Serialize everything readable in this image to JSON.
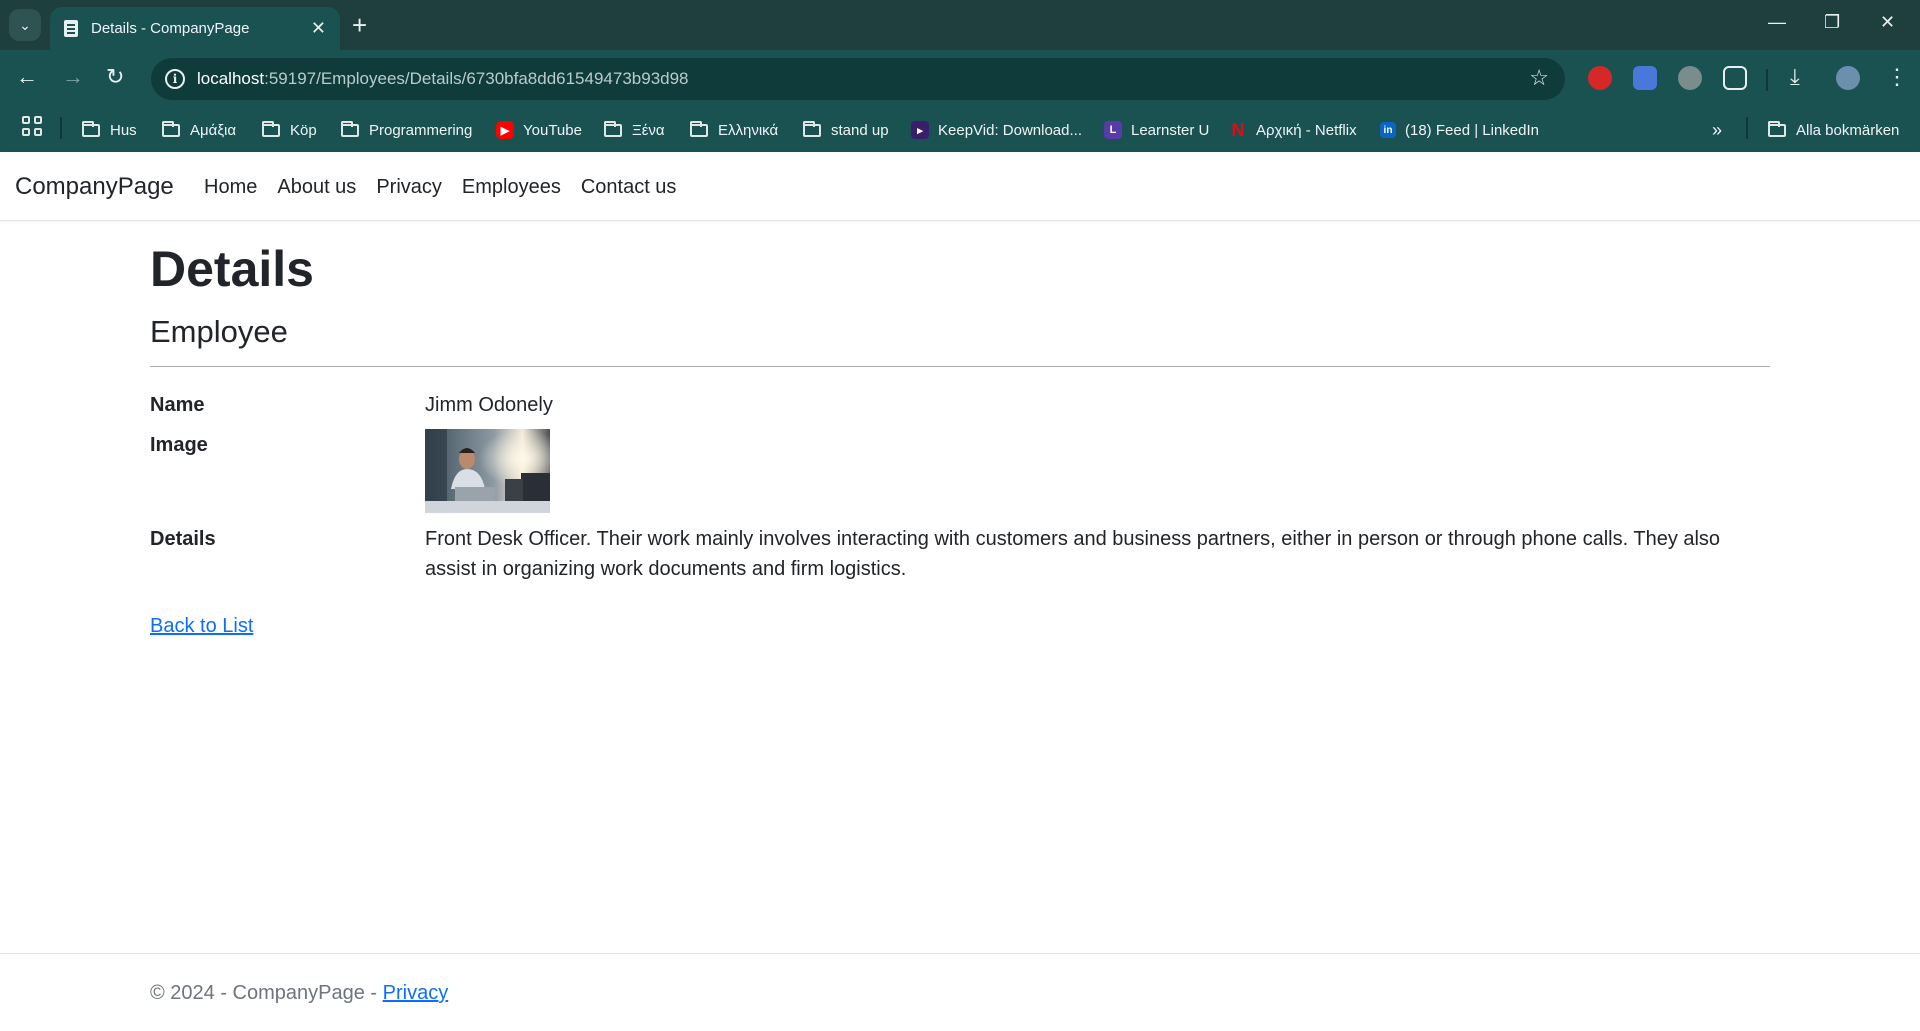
{
  "browser": {
    "tab_title": "Details - CompanyPage",
    "url_host": "localhost",
    "url_rest": ":59197/Employees/Details/6730bfa8dd61549473b93d98",
    "bookmarks": [
      {
        "label": "Hus",
        "icon": "folder-icon"
      },
      {
        "label": "Αμάξια",
        "icon": "folder-icon"
      },
      {
        "label": "Köp",
        "icon": "folder-icon"
      },
      {
        "label": "Programmering",
        "icon": "folder-icon"
      },
      {
        "label": "YouTube",
        "icon": "youtube-icon"
      },
      {
        "label": "Ξένα",
        "icon": "folder-icon"
      },
      {
        "label": "Ελληνικά",
        "icon": "folder-icon"
      },
      {
        "label": "stand up",
        "icon": "folder-icon"
      },
      {
        "label": "KeepVid: Download...",
        "icon": "keepvid-icon"
      },
      {
        "label": "Learnster U",
        "icon": "learnster-icon"
      },
      {
        "label": "Αρχική - Netflix",
        "icon": "netflix-icon"
      },
      {
        "label": "(18) Feed | LinkedIn",
        "icon": "linkedin-icon"
      }
    ],
    "all_bookmarks": "Alla bokmärken",
    "colors": {
      "chrome_dark": "#1f3e3e",
      "chrome": "#1a5252"
    }
  },
  "site": {
    "brand": "CompanyPage",
    "nav": [
      "Home",
      "About us",
      "Privacy",
      "Employees",
      "Contact us"
    ]
  },
  "page": {
    "title": "Details",
    "subtitle": "Employee",
    "fields": {
      "name_label": "Name",
      "name_value": "Jimm Odonely",
      "image_label": "Image",
      "details_label": "Details",
      "details_value": "Front Desk Officer. Their work mainly involves interacting with customers and business partners, either in person or through phone calls. They also assist in organizing work documents and firm logistics."
    },
    "back_link": "Back to List"
  },
  "footer": {
    "copyright": "© 2024 - CompanyPage - ",
    "privacy": "Privacy"
  }
}
